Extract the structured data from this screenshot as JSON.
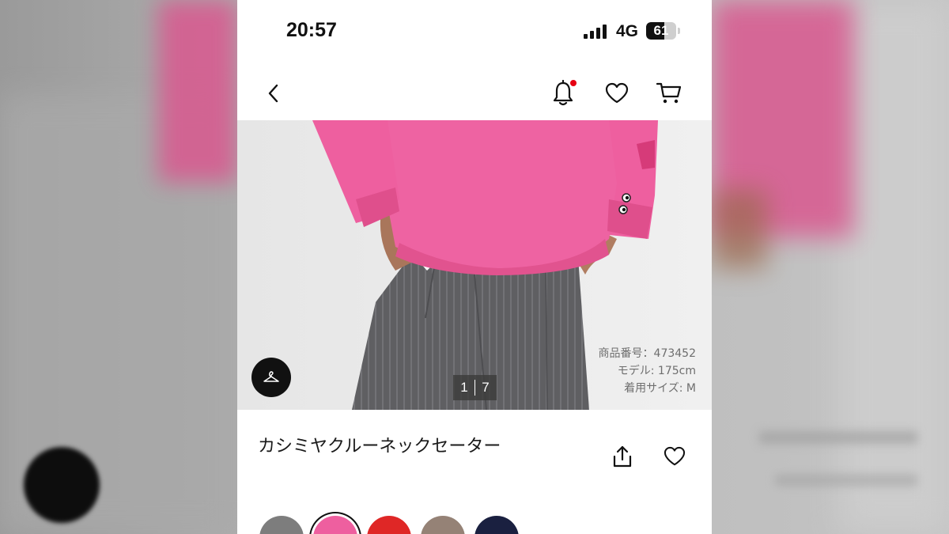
{
  "status_bar": {
    "time": "20:57",
    "network": "4G",
    "battery_level": "61",
    "battery_fraction": 0.61
  },
  "nav": {
    "back_icon": "chevron-left-icon",
    "notification_icon": "bell-icon",
    "notification_dot_color": "#e60012",
    "favorite_icon": "heart-icon",
    "cart_icon": "cart-icon"
  },
  "hero": {
    "info": {
      "product_number": "商品番号：473452",
      "model": "モデル: 175cm",
      "size": "着用サイズ: M"
    },
    "pager": {
      "current": "1",
      "total": "7"
    },
    "hanger_icon": "hanger-icon"
  },
  "product": {
    "title": "カシミヤクルーネックセーター",
    "share_icon": "share-icon",
    "favorite_icon": "heart-icon"
  },
  "colors": {
    "accent": "#e60012",
    "swatches": [
      "#7d7d7d",
      "#ee5f9f",
      "#df2726",
      "#958276",
      "#1a2040"
    ],
    "selected_index": 1
  }
}
